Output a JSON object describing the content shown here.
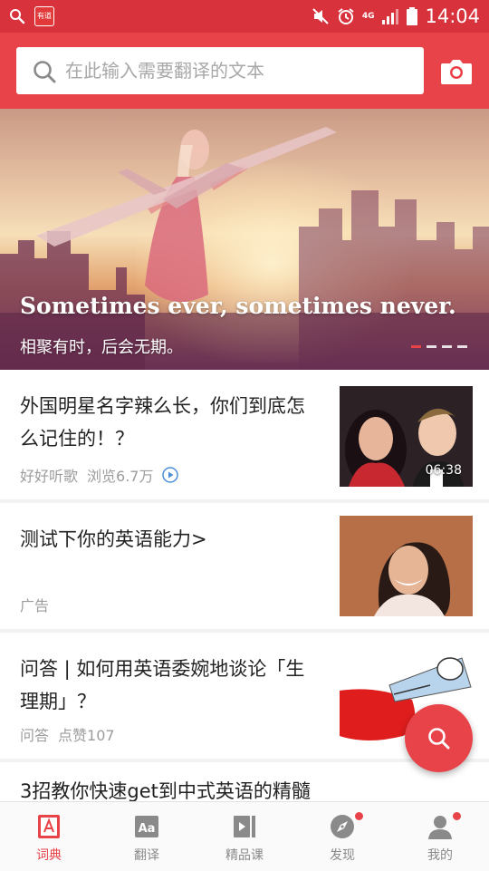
{
  "status_bar": {
    "time": "14:04",
    "network": "4G",
    "app_badge": "有道"
  },
  "search": {
    "placeholder": "在此输入需要翻译的文本"
  },
  "banner": {
    "headline": "Sometimes ever, sometimes never.",
    "subtitle": "相聚有时，后会无期。",
    "page_count": 4,
    "active_page": 1
  },
  "feed": [
    {
      "title": "外国明星名字辣么长，你们到底怎么记住的！？",
      "source": "好好听歌",
      "views": "浏览6.7万",
      "duration": "06:38",
      "has_video": true
    },
    {
      "title": "测试下你的英语能力>",
      "source": "广告"
    },
    {
      "title": "问答 | 如何用英语委婉地谈论「生理期」？",
      "source": "问答",
      "likes": "点赞107"
    },
    {
      "title": "3招教你快速get到中式英语的精髓"
    }
  ],
  "bottom_nav": [
    {
      "label": "词典",
      "icon": "dictionary-icon",
      "active": true
    },
    {
      "label": "翻译",
      "icon": "translate-icon"
    },
    {
      "label": "精品课",
      "icon": "course-icon"
    },
    {
      "label": "发现",
      "icon": "discover-compass-icon",
      "badge": true
    },
    {
      "label": "我的",
      "icon": "profile-icon",
      "badge": true
    }
  ],
  "colors": {
    "brand_red": "#e84349",
    "status_red": "#d8323c",
    "text": "#222222",
    "meta_gray": "#9c9c9c",
    "nav_gray": "#8a8a8a"
  }
}
